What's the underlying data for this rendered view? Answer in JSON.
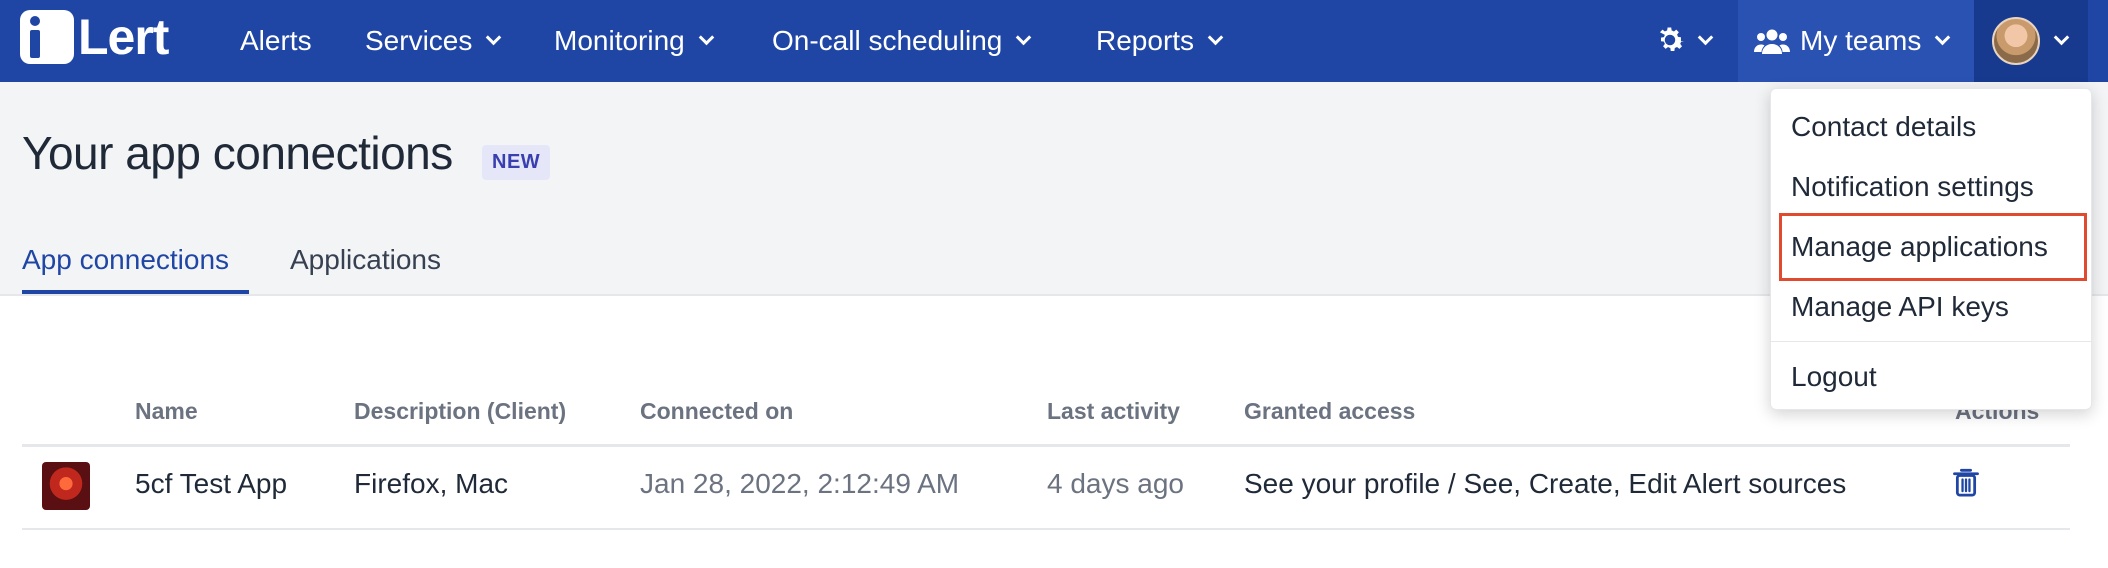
{
  "nav": {
    "logo_text": "Lert",
    "items": [
      "Alerts",
      "Services",
      "Monitoring",
      "On-call scheduling",
      "Reports"
    ],
    "teams_label": "My teams"
  },
  "page": {
    "title": "Your app connections",
    "badge": "NEW",
    "tabs": [
      "App connections",
      "Applications"
    ]
  },
  "table": {
    "headers": [
      "Name",
      "Description (Client)",
      "Connected on",
      "Last activity",
      "Granted access",
      "Actions"
    ],
    "rows": [
      {
        "name": "5cf Test App",
        "description": "Firefox, Mac",
        "connected_on": "Jan 28, 2022, 2:12:49 AM",
        "last_activity": "4 days ago",
        "granted_access": "See your profile / See, Create, Edit Alert sources"
      }
    ]
  },
  "user_menu": {
    "items": [
      "Contact details",
      "Notification settings",
      "Manage applications",
      "Manage API keys",
      "Logout"
    ],
    "highlighted": "Manage applications"
  },
  "colors": {
    "nav_bg": "#2046a5",
    "accent": "#2046a5",
    "highlight_border": "#e04a2f"
  }
}
